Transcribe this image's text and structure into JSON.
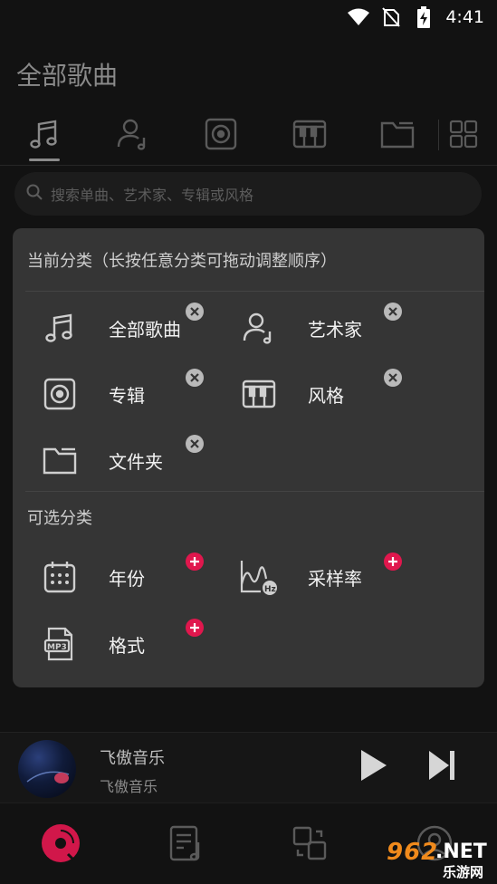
{
  "status_bar": {
    "time": "4:41"
  },
  "page_title": "全部歌曲",
  "tabs": [
    {
      "name": "songs",
      "icon": "music-note-icon"
    },
    {
      "name": "artists",
      "icon": "artist-icon"
    },
    {
      "name": "albums",
      "icon": "album-icon"
    },
    {
      "name": "genres",
      "icon": "piano-icon"
    },
    {
      "name": "folders",
      "icon": "folder-icon"
    },
    {
      "name": "more",
      "icon": "grid-icon"
    }
  ],
  "search": {
    "placeholder": "搜索单曲、艺术家、专辑或风格"
  },
  "panel": {
    "current_header": "当前分类（长按任意分类可拖动调整顺序）",
    "current": [
      {
        "label": "全部歌曲",
        "icon": "music-note-icon"
      },
      {
        "label": "艺术家",
        "icon": "artist-icon"
      },
      {
        "label": "专辑",
        "icon": "album-icon"
      },
      {
        "label": "风格",
        "icon": "piano-icon"
      },
      {
        "label": "文件夹",
        "icon": "folder-icon"
      }
    ],
    "optional_header": "可选分类",
    "optional": [
      {
        "label": "年份",
        "icon": "calendar-icon"
      },
      {
        "label": "采样率",
        "icon": "hz-wave-icon",
        "badge_text": "Hz"
      },
      {
        "label": "格式",
        "icon": "mp3-file-icon",
        "badge_text": "MP3"
      }
    ]
  },
  "player": {
    "title": "飞傲音乐",
    "artist": "飞傲音乐"
  },
  "bottom_nav": [
    {
      "name": "music",
      "icon": "vinyl-icon",
      "active": true
    },
    {
      "name": "playlist",
      "icon": "playlist-icon"
    },
    {
      "name": "sync",
      "icon": "sync-icon"
    },
    {
      "name": "profile",
      "icon": "profile-icon"
    }
  ],
  "watermark": {
    "number": "962",
    "suffix": ".NET",
    "cn": "乐游网"
  },
  "colors": {
    "accent": "#e0174d",
    "panel": "#353535",
    "background": "#121212",
    "watermark_orange": "#f08a1c"
  }
}
